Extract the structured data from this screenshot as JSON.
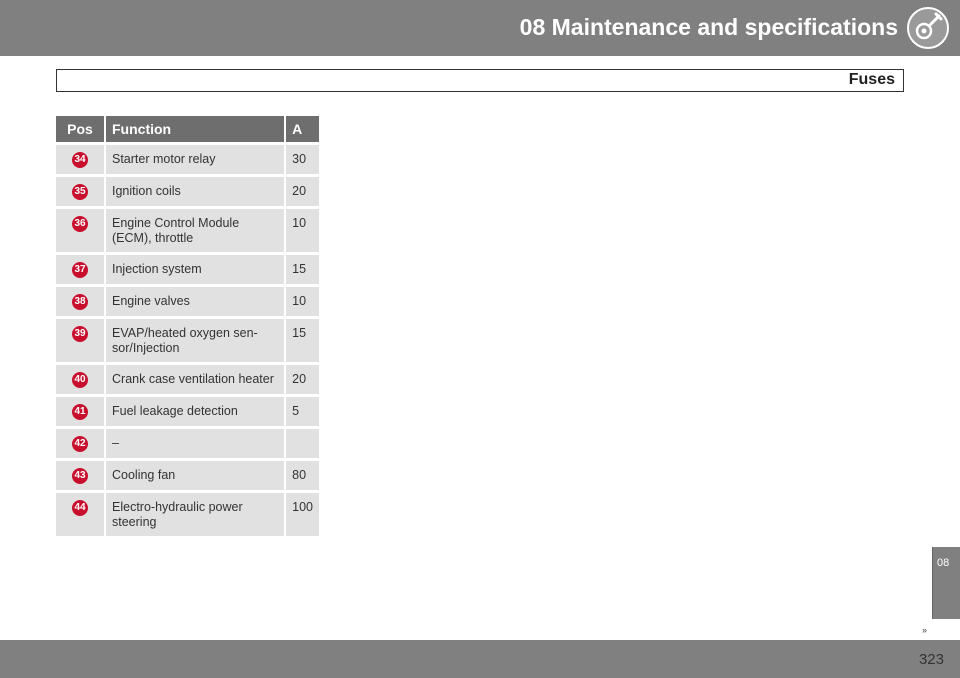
{
  "header": {
    "title": "08 Maintenance and specifications",
    "icon": "wrench-gear-icon"
  },
  "section": {
    "title": "Fuses"
  },
  "table": {
    "columns": [
      "Pos",
      "Function",
      "A"
    ],
    "rows": [
      {
        "pos": "34",
        "function": "Starter motor relay",
        "amps": "30"
      },
      {
        "pos": "35",
        "function": "Ignition coils",
        "amps": "20"
      },
      {
        "pos": "36",
        "function": "Engine Control Module (ECM), throttle",
        "amps": "10"
      },
      {
        "pos": "37",
        "function": "Injection system",
        "amps": "15"
      },
      {
        "pos": "38",
        "function": "Engine valves",
        "amps": "10"
      },
      {
        "pos": "39",
        "function": "EVAP/heated oxygen sen-sor/Injection",
        "amps": "15"
      },
      {
        "pos": "40",
        "function": "Crank case ventilation heater",
        "amps": "20"
      },
      {
        "pos": "41",
        "function": "Fuel leakage detection",
        "amps": "5"
      },
      {
        "pos": "42",
        "function": "–",
        "amps": ""
      },
      {
        "pos": "43",
        "function": "Cooling fan",
        "amps": "80"
      },
      {
        "pos": "44",
        "function": "Electro-hydraulic power steering",
        "amps": "100"
      }
    ]
  },
  "chapter_tab": {
    "label": "08"
  },
  "nav_arrows": "››",
  "footer": {
    "page_number": "323"
  },
  "colors": {
    "header_gray": "#808080",
    "circle_red": "#c8102e",
    "cell_gray": "#e1e1e1"
  }
}
